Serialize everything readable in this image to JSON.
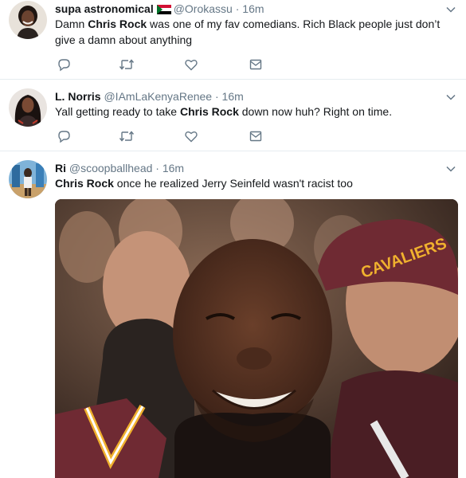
{
  "tweets": [
    {
      "name": "supa astronomical",
      "flag_icon": "sudan-flag-icon",
      "handle": "@Orokassu",
      "dot": "·",
      "time": "16m",
      "text_pre": "Damn ",
      "text_bold": "Chris Rock",
      "text_post": " was one of my fav comedians. Rich Black people just don’t give a damn about anything",
      "actions": [
        "reply-icon",
        "retweet-icon",
        "like-icon",
        "message-icon"
      ]
    },
    {
      "name": "L. Norris",
      "handle": "@IAmLaKenyaRenee",
      "dot": "·",
      "time": "16m",
      "text_pre": "Yall getting ready to take ",
      "text_bold": "Chris Rock",
      "text_post": " down now huh? Right on time.",
      "actions": [
        "reply-icon",
        "retweet-icon",
        "like-icon",
        "message-icon"
      ]
    },
    {
      "name": "Ri",
      "handle": "@scoopballhead",
      "dot": "·",
      "time": "16m",
      "text_pre": "",
      "text_bold": "Chris Rock",
      "text_post": " once he realized Jerry Seinfeld wasn't racist too",
      "media": {
        "cap_text": "CAVALIERS",
        "cap_color": "#6f2a33",
        "jersey_accent": "#f0b12e"
      }
    }
  ],
  "colors": {
    "text": "#14171a",
    "muted": "#657786",
    "divider": "#e6ecf0",
    "icon": "#657786"
  }
}
